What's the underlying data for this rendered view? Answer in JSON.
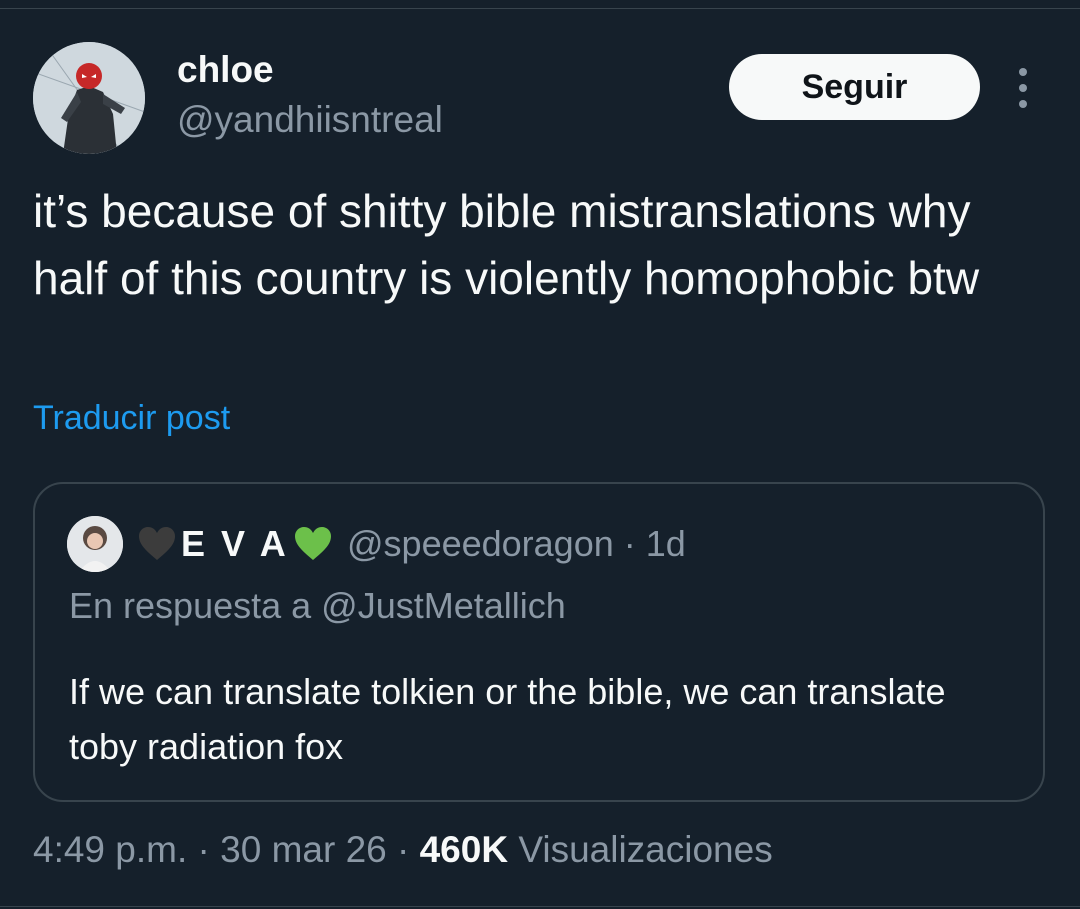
{
  "author": {
    "display_name": "chloe",
    "handle": "@yandhiisntreal",
    "avatar_icon": "spiderman-avatar"
  },
  "actions": {
    "follow_label": "Seguir",
    "more_icon": "more-vertical-icon"
  },
  "tweet": {
    "text": "it’s because of shitty bible mistranslations why half of this country is violently homophobic btw",
    "translate_label": "Traducir post"
  },
  "quoted": {
    "name_prefix_emoji": "🖤",
    "display_name": "E V A",
    "name_suffix_emoji": "💚",
    "handle_time": "@speeedoragon · 1d",
    "reply_context": "En respuesta a @JustMetallich",
    "text": "If we can translate tolkien or the bible, we can translate toby radiation fox"
  },
  "meta": {
    "timestamp": "4:49 p.m. · 30 mar 26 · ",
    "views_count": "460K",
    "views_label": " Visualizaciones"
  },
  "colors": {
    "background": "#15202b",
    "primary_text": "#f7f9f9",
    "secondary_text": "#8b98a5",
    "link": "#1d9bf0",
    "border": "#38444d"
  }
}
